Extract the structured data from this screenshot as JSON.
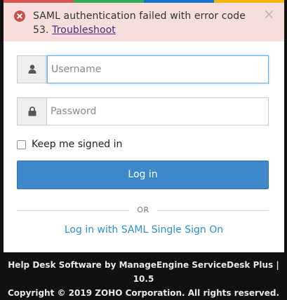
{
  "colors": {
    "strip": [
      "#d9534f",
      "#34a853",
      "#1a73c8",
      "#f0b90b"
    ],
    "alert_bg": "#f6dedd",
    "alert_icon": "#c7504b",
    "link": "#4b2a80",
    "button": "#3e87c8",
    "saml_link": "#2a8fd0"
  },
  "alert": {
    "icon": "error-circle-icon",
    "message": "SAML authentication failed with error code 53.",
    "link_text": "Troubleshoot",
    "close_symbol": "×"
  },
  "login": {
    "username_placeholder": "Username",
    "username_icon": "user-icon",
    "password_placeholder": "Password",
    "password_icon": "lock-icon",
    "remember_label": "Keep me signed in",
    "remember_checked": false,
    "button_label": "Log in",
    "or_text": "OR",
    "saml_link": "Log in with SAML Single Sign On"
  },
  "footer": {
    "line1": "Help Desk Software by ManageEngine ServiceDesk Plus | 10.5",
    "line2": "Copyright © 2019 ZOHO Corporation. All rights reserved."
  }
}
